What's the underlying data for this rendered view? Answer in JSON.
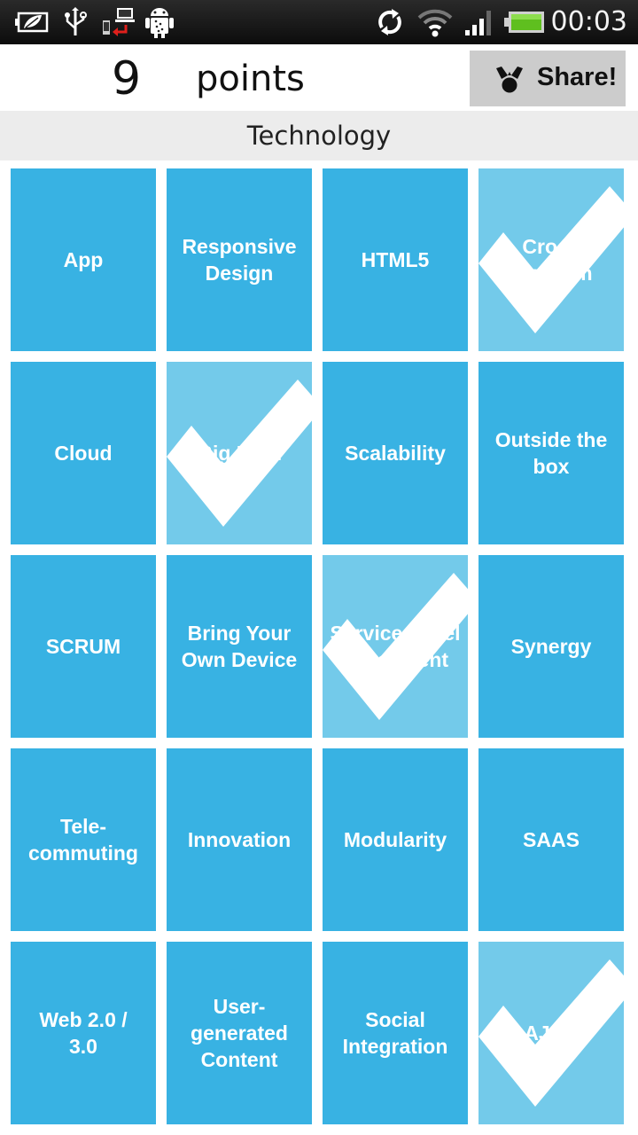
{
  "status_bar": {
    "time": "00:03",
    "left_icons": [
      "battery-saver-icon",
      "usb-icon",
      "phone-pc-sync-icon",
      "android-debug-icon"
    ],
    "right_icons": [
      "sync-icon",
      "wifi-icon",
      "signal-icon",
      "battery-icon"
    ],
    "battery_color": "#5fbf1f"
  },
  "header": {
    "score": "9",
    "points_label": "points",
    "share_label": "Share!",
    "share_icon": "share-icon"
  },
  "category": {
    "title": "Technology"
  },
  "colors": {
    "tile": "#38b2e3",
    "tile_checked": "#73caea",
    "header_band": "#ececec",
    "share_button": "#cccccc"
  },
  "board": {
    "columns": 4,
    "rows": 5,
    "cells": [
      {
        "label": "App",
        "checked": false
      },
      {
        "label": "Responsive\nDesign",
        "checked": false
      },
      {
        "label": "HTML5",
        "checked": false
      },
      {
        "label": "Cross\nPlatform",
        "checked": true
      },
      {
        "label": "Cloud",
        "checked": false
      },
      {
        "label": "Big Data",
        "checked": true
      },
      {
        "label": "Scalability",
        "checked": false
      },
      {
        "label": "Outside the\nbox",
        "checked": false
      },
      {
        "label": "SCRUM",
        "checked": false
      },
      {
        "label": "Bring Your\nOwn Device",
        "checked": false
      },
      {
        "label": "Service Level\nAgreement",
        "checked": true
      },
      {
        "label": "Synergy",
        "checked": false
      },
      {
        "label": "Tele-\ncommuting",
        "checked": false
      },
      {
        "label": "Innovation",
        "checked": false
      },
      {
        "label": "Modularity",
        "checked": false
      },
      {
        "label": "SAAS",
        "checked": false
      },
      {
        "label": "Web 2.0 /\n3.0",
        "checked": false
      },
      {
        "label": "User-\ngenerated\nContent",
        "checked": false
      },
      {
        "label": "Social\nIntegration",
        "checked": false
      },
      {
        "label": "AJAX",
        "checked": true
      }
    ]
  }
}
